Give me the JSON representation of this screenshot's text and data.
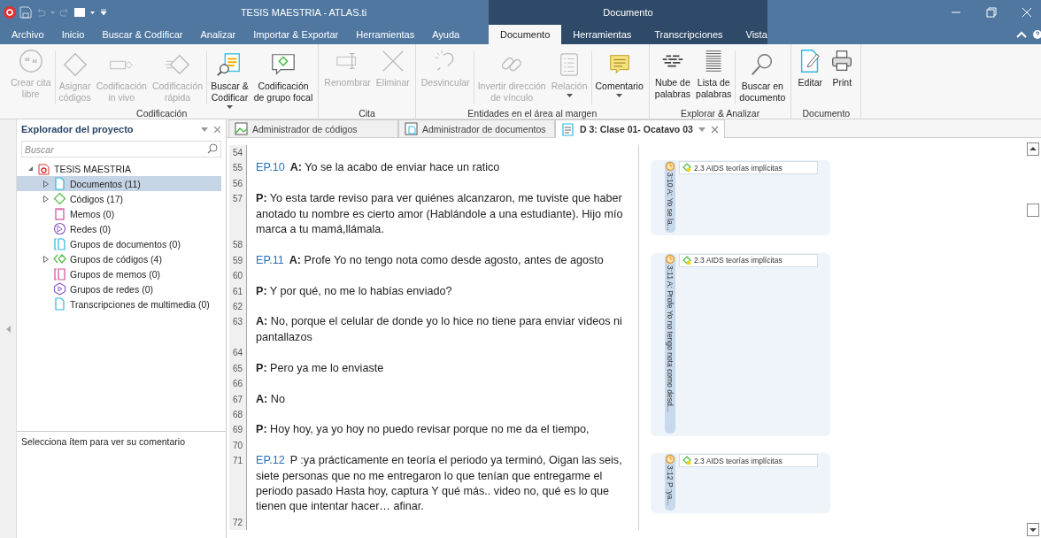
{
  "window": {
    "title": "TESIS MAESTRIA - ATLAS.ti",
    "context_title": "Documento"
  },
  "menu": {
    "tabs": [
      {
        "label": "Archivo",
        "selected": false,
        "contextual": false
      },
      {
        "label": "Inicio",
        "selected": false,
        "contextual": false
      },
      {
        "label": "Buscar & Codificar",
        "selected": false,
        "contextual": false
      },
      {
        "label": "Analizar",
        "selected": false,
        "contextual": false
      },
      {
        "label": "Importar & Exportar",
        "selected": false,
        "contextual": false
      },
      {
        "label": "Herramientas",
        "selected": false,
        "contextual": false
      },
      {
        "label": "Ayuda",
        "selected": false,
        "contextual": false
      },
      {
        "label": "Documento",
        "selected": true,
        "contextual": true
      },
      {
        "label": "Herramientas",
        "selected": false,
        "contextual": true
      },
      {
        "label": "Transcripciones",
        "selected": false,
        "contextual": true
      },
      {
        "label": "Vista",
        "selected": false,
        "contextual": true
      }
    ]
  },
  "ribbon": {
    "groups": [
      {
        "label": "Codificación",
        "sections": [
          {
            "buttons": [
              {
                "label": "Crear cita\nlibre",
                "disabled": true,
                "dropdown": false
              }
            ]
          },
          {
            "buttons": [
              {
                "label": "Asignar\ncódigos",
                "disabled": true,
                "dropdown": false
              },
              {
                "label": "Codificación\nin vivo",
                "disabled": true,
                "dropdown": false
              },
              {
                "label": "Codificación\nrápida",
                "disabled": true,
                "dropdown": false
              }
            ]
          },
          {
            "buttons": [
              {
                "label": "Buscar &\nCodificar",
                "disabled": false,
                "dropdown": true
              },
              {
                "label": "Codificación\nde grupo focal",
                "disabled": false,
                "dropdown": false
              }
            ]
          }
        ]
      },
      {
        "label": "Cita",
        "sections": [
          {
            "buttons": [
              {
                "label": "Renombrar",
                "disabled": true,
                "dropdown": false
              },
              {
                "label": "Eliminar",
                "disabled": true,
                "dropdown": false
              }
            ]
          }
        ]
      },
      {
        "label": "Entidades en el área al margen",
        "sections": [
          {
            "buttons": [
              {
                "label": "Desvincular",
                "disabled": true,
                "dropdown": false
              }
            ]
          },
          {
            "buttons": [
              {
                "label": "Invertir dirección\nde vínculo",
                "disabled": true,
                "dropdown": false
              },
              {
                "label": "Relación",
                "disabled": true,
                "dropdown": true
              }
            ]
          },
          {
            "buttons": [
              {
                "label": "Comentario",
                "disabled": false,
                "dropdown": true
              }
            ]
          }
        ]
      },
      {
        "label": "Explorar & Analizar",
        "sections": [
          {
            "buttons": [
              {
                "label": "Nube de\npalabras",
                "disabled": false,
                "dropdown": false
              },
              {
                "label": "Lista de\npalabras",
                "disabled": false,
                "dropdown": false
              }
            ]
          },
          {
            "buttons": [
              {
                "label": "Buscar en\ndocumento",
                "disabled": false,
                "dropdown": false
              }
            ]
          }
        ]
      },
      {
        "label": "Documento",
        "sections": [
          {
            "buttons": [
              {
                "label": "Editar",
                "disabled": false,
                "dropdown": false
              },
              {
                "label": "Print",
                "disabled": false,
                "dropdown": false
              }
            ]
          }
        ]
      }
    ]
  },
  "explorer": {
    "title": "Explorador del proyecto",
    "search": {
      "placeholder": "Buscar"
    },
    "tree": [
      {
        "label": "TESIS MAESTRIA",
        "kind": "project",
        "expanded": true,
        "selected": false,
        "children": [
          {
            "label": "Documentos (11)",
            "kind": "document",
            "expandable": true,
            "selected": true
          },
          {
            "label": "Códigos (17)",
            "kind": "code",
            "expandable": true,
            "selected": false
          },
          {
            "label": "Memos (0)",
            "kind": "memo",
            "expandable": false,
            "selected": false
          },
          {
            "label": "Redes (0)",
            "kind": "network",
            "expandable": false,
            "selected": false
          },
          {
            "label": "Grupos de documentos (0)",
            "kind": "document_group",
            "expandable": false,
            "selected": false
          },
          {
            "label": "Grupos de códigos (4)",
            "kind": "code_group",
            "expandable": true,
            "selected": false
          },
          {
            "label": "Grupos de memos (0)",
            "kind": "memo_group",
            "expandable": false,
            "selected": false
          },
          {
            "label": "Grupos de redes (0)",
            "kind": "network_group",
            "expandable": false,
            "selected": false
          },
          {
            "label": "Transcripciones de multimedia (0)",
            "kind": "transcript",
            "expandable": false,
            "selected": false
          }
        ]
      }
    ],
    "comment_hint": "Selecciona ítem para ver su comentario"
  },
  "doc_tabs": [
    {
      "label": "Administrador de códigos",
      "kind": "code_manager",
      "selected": false
    },
    {
      "label": "Administrador de documentos",
      "kind": "document_manager",
      "selected": false
    },
    {
      "label": "D 3: Clase 01- Ocatavo 03",
      "kind": "document",
      "selected": true
    }
  ],
  "document": {
    "segments": [
      {
        "lines": [
          {
            "number": "54"
          }
        ]
      },
      {
        "lines": [
          {
            "number": "55",
            "ref": "EP.10",
            "text": "**A:** Yo se la acabo de enviar hace un ratico"
          },
          {
            "number": "56"
          },
          {
            "number": "57",
            "text": "**P:**  Yo esta tarde reviso para ver quiénes alcanzaron,  me tuviste que haber anotado tu nombre es cierto amor (Hablándole a una estudiante). Hijo mío marca a tu mamá,llámala."
          }
        ],
        "quotation": {
          "label": "3:10 A: Yo se la...",
          "code": "2.3 AIDS teorías implícitas"
        }
      },
      {
        "lines": [
          {
            "number": "58"
          }
        ]
      },
      {
        "lines": [
          {
            "number": "59",
            "ref": "EP.11",
            "text": "**A:** Profe Yo no tengo nota como desde agosto,  antes de agosto"
          },
          {
            "number": "60"
          },
          {
            "number": "61",
            "text": "**P:** Y por qué,  no me lo habías enviado?"
          },
          {
            "number": "62"
          },
          {
            "number": "63",
            "text": "**A:** No,  porque el celular de donde yo lo hice no tiene para enviar videos ni pantallazos"
          },
          {
            "number": "64"
          },
          {
            "number": "65",
            "text": "**P:** Pero ya me lo enviaste"
          },
          {
            "number": "66"
          },
          {
            "number": "67",
            "text": "**A:** No"
          },
          {
            "number": "68"
          },
          {
            "number": "69",
            "text": "**P:** Hoy hoy, ya yo hoy no puedo revisar porque no me da el tiempo,"
          }
        ],
        "quotation": {
          "label": "3:11 A: Profe Yo no tengo nota como desd...",
          "code": "2.3 AIDS teorías implícitas"
        }
      },
      {
        "lines": [
          {
            "number": "70"
          }
        ]
      },
      {
        "lines": [
          {
            "number": "71",
            "ref": "EP.12",
            "text": "P :ya prácticamente en teoría el periodo ya terminó, Oigan las seis, siete  personas que no me entregaron lo que tenían que entregarme el periodo pasado Hasta hoy,  captura Y qué más.. video no,  qué es lo que tienen que intentar hacer… afinar."
          }
        ],
        "quotation": {
          "label": "3:12 P :ya...",
          "code": "2.3 AIDS teorías implícitas"
        }
      },
      {
        "lines": [
          {
            "number": "72"
          }
        ]
      }
    ]
  }
}
